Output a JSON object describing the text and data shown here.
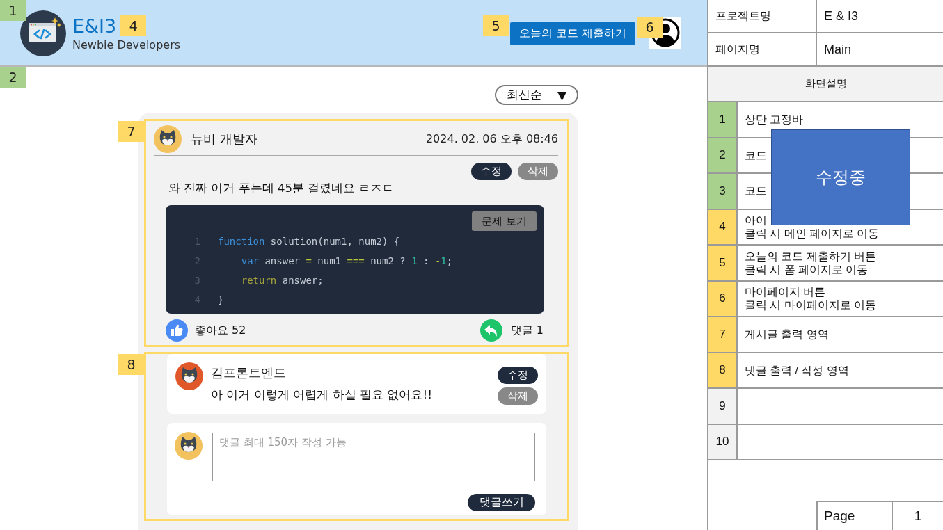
{
  "header": {
    "marker": {
      "label": "1",
      "color": "#a9d18e"
    },
    "logo": {
      "title": "E&I3",
      "subtitle": "Newbie Developers",
      "marker": {
        "label": "4",
        "color": "#ffd966"
      }
    },
    "submit_button": {
      "label": "오늘의 코드 제출하기",
      "marker": {
        "label": "5",
        "color": "#ffd966"
      }
    },
    "profile": {
      "marker": {
        "label": "6",
        "color": "#ffd966"
      }
    }
  },
  "main": {
    "marker": {
      "label": "2",
      "color": "#a9d18e"
    },
    "sort": {
      "label": "최신순",
      "caret": "▼"
    },
    "post": {
      "marker": {
        "label": "7",
        "color": "#ffd966"
      },
      "author": "뉴비 개발자",
      "date": "2024. 02. 06 오후 08:46",
      "edit": "수정",
      "delete": "삭제",
      "text": "와 진짜 이거 푸는데 45분 걸렸네요 ㄹㅈㄷ",
      "problem_button": "문제 보기",
      "code": [
        {
          "number": "1",
          "tokens": [
            {
              "kind": "keyword",
              "text": "function"
            },
            {
              "kind": "plain",
              "text": " solution(num1, num2) {"
            }
          ]
        },
        {
          "number": "2",
          "indented": true,
          "tokens": [
            {
              "kind": "keyword",
              "text": "var"
            },
            {
              "kind": "plain",
              "text": " answer "
            },
            {
              "kind": "operator",
              "text": "="
            },
            {
              "kind": "plain",
              "text": " num1 "
            },
            {
              "kind": "operator",
              "text": "==="
            },
            {
              "kind": "plain",
              "text": " num2 ? "
            },
            {
              "kind": "number",
              "text": "1"
            },
            {
              "kind": "plain",
              "text": " : "
            },
            {
              "kind": "operator",
              "text": "-"
            },
            {
              "kind": "number",
              "text": "1"
            },
            {
              "kind": "plain",
              "text": ";"
            }
          ]
        },
        {
          "number": "3",
          "indented": true,
          "tokens": [
            {
              "kind": "control",
              "text": "return"
            },
            {
              "kind": "plain",
              "text": " answer;"
            }
          ]
        },
        {
          "number": "4",
          "tokens": [
            {
              "kind": "plain",
              "text": "}"
            }
          ]
        }
      ],
      "likes": "좋아요 52",
      "replies": "댓글 1"
    },
    "comments": {
      "marker": {
        "label": "8",
        "color": "#ffd966"
      },
      "items": [
        {
          "author": "김프론트엔드",
          "text": "아 이거 이렇게 어렵게 하실 필요 없어요!!",
          "edit": "수정",
          "delete": "삭제"
        }
      ],
      "compose": {
        "placeholder": "댓글 최대 150자 작성 가능",
        "submit": "댓글쓰기"
      }
    }
  },
  "panel": {
    "info": [
      {
        "label": "프로젝트명",
        "value": "E & I3"
      },
      {
        "label": "페이지명",
        "value": "Main"
      }
    ],
    "heading": "화면설명",
    "rows": [
      {
        "number": "1",
        "color": "#a9d18e",
        "lines": [
          "상단 고정바"
        ]
      },
      {
        "number": "2",
        "color": "#a9d18e",
        "lines": [
          "코드"
        ]
      },
      {
        "number": "3",
        "color": "#a9d18e",
        "lines": [
          "코드"
        ]
      },
      {
        "number": "4",
        "color": "#ffd966",
        "lines": [
          "아이",
          "클릭 시 메인 페이지로 이동"
        ]
      },
      {
        "number": "5",
        "color": "#ffd966",
        "lines": [
          "오늘의 코드 제출하기 버튼",
          "클릭 시 폼 페이지로 이동"
        ]
      },
      {
        "number": "6",
        "color": "#ffd966",
        "lines": [
          "마이페이지 버튼",
          "클릭 시 마이페이지로 이동"
        ]
      },
      {
        "number": "7",
        "color": "#ffd966",
        "lines": [
          "게시글 출력 영역"
        ]
      },
      {
        "number": "8",
        "color": "#ffd966",
        "lines": [
          "댓글 출력 / 작성 영역"
        ]
      },
      {
        "number": "9",
        "color": "#f2f2f2"
      },
      {
        "number": "10",
        "color": "#f2f2f2"
      }
    ],
    "overlay": {
      "label": "수정중"
    },
    "page": {
      "label": "Page",
      "value": "1"
    }
  }
}
